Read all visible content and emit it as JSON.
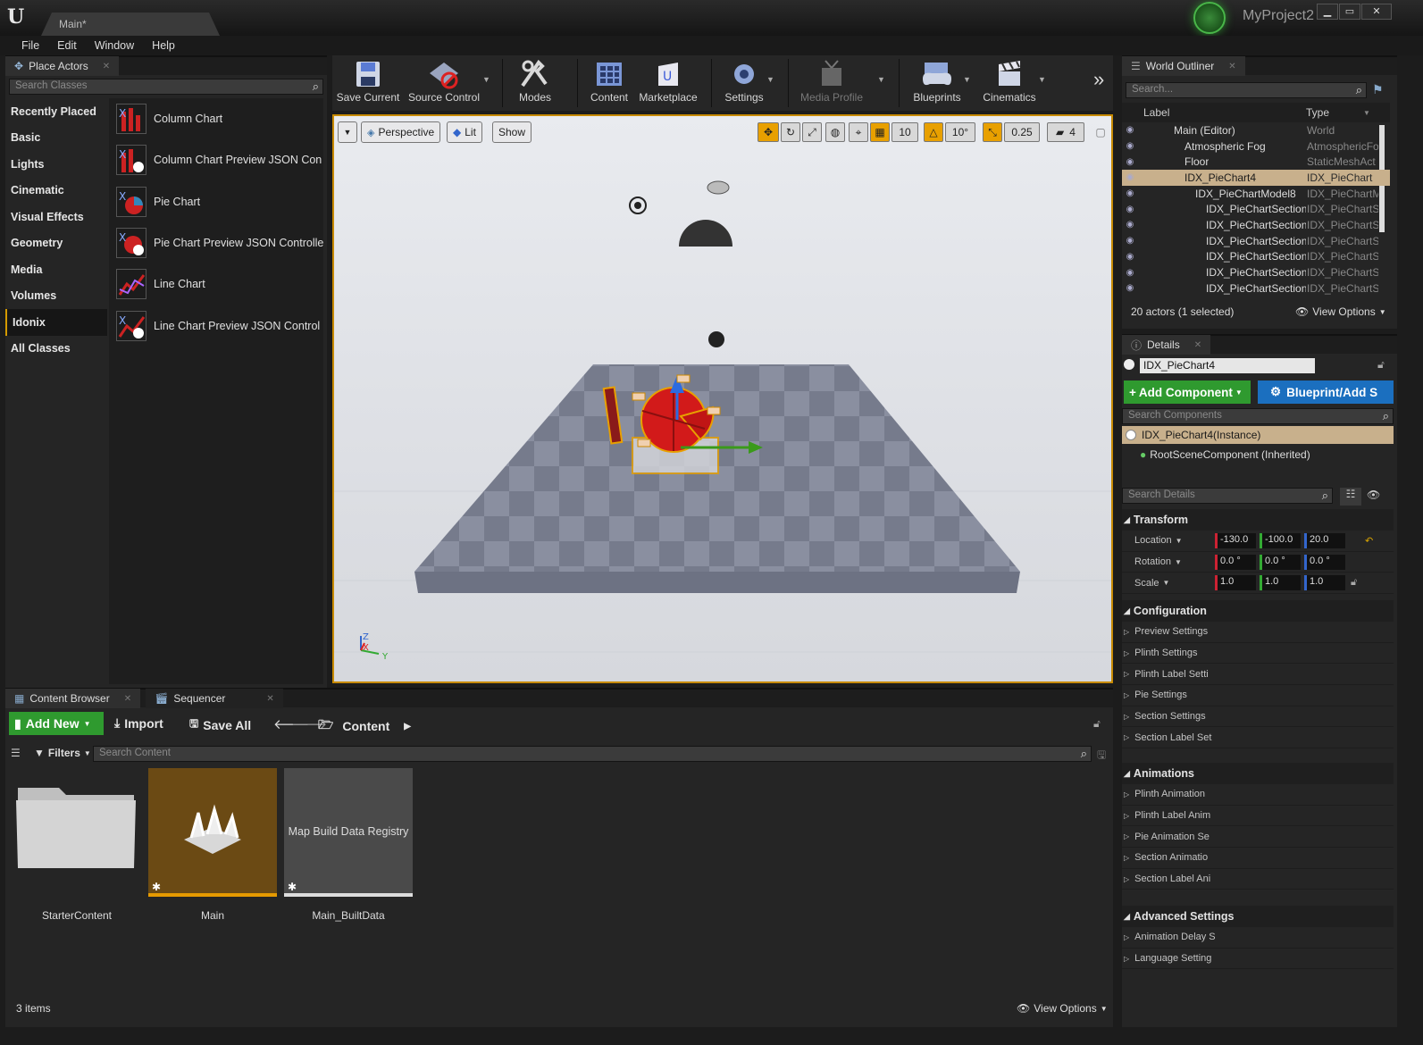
{
  "titlebar": {
    "tab_label": "Main*",
    "project_name": "MyProject2",
    "window_buttons": [
      "minimize",
      "maximize",
      "close"
    ]
  },
  "menu": [
    "File",
    "Edit",
    "Window",
    "Help"
  ],
  "place_actors": {
    "tab_label": "Place Actors",
    "search_placeholder": "Search Classes",
    "categories": [
      "Recently Placed",
      "Basic",
      "Lights",
      "Cinematic",
      "Visual Effects",
      "Geometry",
      "Media",
      "Volumes",
      "Idonix",
      "All Classes"
    ],
    "selected_category": "Idonix",
    "actors": [
      "Column Chart",
      "Column Chart Preview JSON Con",
      "Pie Chart",
      "Pie Chart Preview JSON Controlle",
      "Line Chart",
      "Line Chart Preview JSON Control"
    ]
  },
  "toolbar": {
    "buttons": [
      "Save Current",
      "Source Control",
      "Modes",
      "Content",
      "Marketplace",
      "Settings",
      "Media Profile",
      "Blueprints",
      "Cinematics"
    ]
  },
  "viewport": {
    "perspective_label": "Perspective",
    "lit_label": "Lit",
    "show_label": "Show",
    "grid_snap": "10",
    "rotation_snap": "10°",
    "scale_snap": "0.25",
    "camera_speed": "4",
    "axis_labels": [
      "Z",
      "X",
      "Y"
    ]
  },
  "outliner": {
    "tab_label": "World Outliner",
    "search_placeholder": "Search...",
    "col_label": "Label",
    "col_type": "Type",
    "rows": [
      {
        "label": "Main (Editor)",
        "type": "World"
      },
      {
        "label": "Atmospheric Fog",
        "type": "AtmosphericFo"
      },
      {
        "label": "Floor",
        "type": "StaticMeshAct"
      },
      {
        "label": "IDX_PieChart4",
        "type": "IDX_PieChart"
      },
      {
        "label": "IDX_PieChartModel8",
        "type": "IDX_PieChartM"
      },
      {
        "label": "IDX_PieChartSectionL",
        "type": "IDX_PieChartS"
      },
      {
        "label": "IDX_PieChartSectionL",
        "type": "IDX_PieChartS"
      },
      {
        "label": "IDX_PieChartSectionL",
        "type": "IDX_PieChartS"
      },
      {
        "label": "IDX_PieChartSectionL",
        "type": "IDX_PieChartS"
      },
      {
        "label": "IDX_PieChartSectionL",
        "type": "IDX_PieChartS"
      },
      {
        "label": "IDX_PieChartSectionM",
        "type": "IDX_PieChartS"
      }
    ],
    "status": "20 actors (1 selected)",
    "view_options": "View Options"
  },
  "details": {
    "tab_label": "Details",
    "actor_name": "IDX_PieChart4",
    "add_component": "Add Component",
    "blueprint_add": "Blueprint/Add S",
    "search_components_placeholder": "Search Components",
    "component_instance": "IDX_PieChart4(Instance)",
    "root_component": "RootSceneComponent (Inherited)",
    "search_details_placeholder": "Search Details",
    "transform": {
      "title": "Transform",
      "location_label": "Location",
      "location": [
        "-130.0",
        "-100.0",
        "20.0"
      ],
      "rotation_label": "Rotation",
      "rotation": [
        "0.0 °",
        "0.0 °",
        "0.0 °"
      ],
      "scale_label": "Scale",
      "scale": [
        "1.0",
        "1.0",
        "1.0"
      ]
    },
    "configuration": {
      "title": "Configuration",
      "items": [
        "Preview Settings",
        "Plinth Settings",
        "Plinth Label Setti",
        "Pie Settings",
        "Section Settings",
        "Section Label Set"
      ]
    },
    "animations": {
      "title": "Animations",
      "items": [
        "Plinth Animation",
        "Plinth Label Anim",
        "Pie Animation Se",
        "Section Animatio",
        "Section Label Ani"
      ]
    },
    "advanced": {
      "title": "Advanced Settings",
      "items": [
        "Animation Delay S",
        "Language Setting"
      ]
    }
  },
  "content_browser": {
    "tab_label": "Content Browser",
    "sequencer_tab": "Sequencer",
    "add_new": "Add New",
    "import": "Import",
    "save_all": "Save All",
    "path": "Content",
    "filters": "Filters",
    "search_placeholder": "Search Content",
    "assets": [
      {
        "name": "StarterContent",
        "kind": "folder"
      },
      {
        "name": "Main",
        "kind": "level"
      },
      {
        "name": "Main_BuiltData",
        "kind": "data",
        "thumb_text": "Map Build Data Registry"
      }
    ],
    "item_count": "3 items",
    "view_options": "View Options"
  },
  "colors": {
    "accent": "#c78a00",
    "selection": "#c8b08c",
    "add_green": "#2f9a2f",
    "blueprint_blue": "#1b6fbf"
  }
}
